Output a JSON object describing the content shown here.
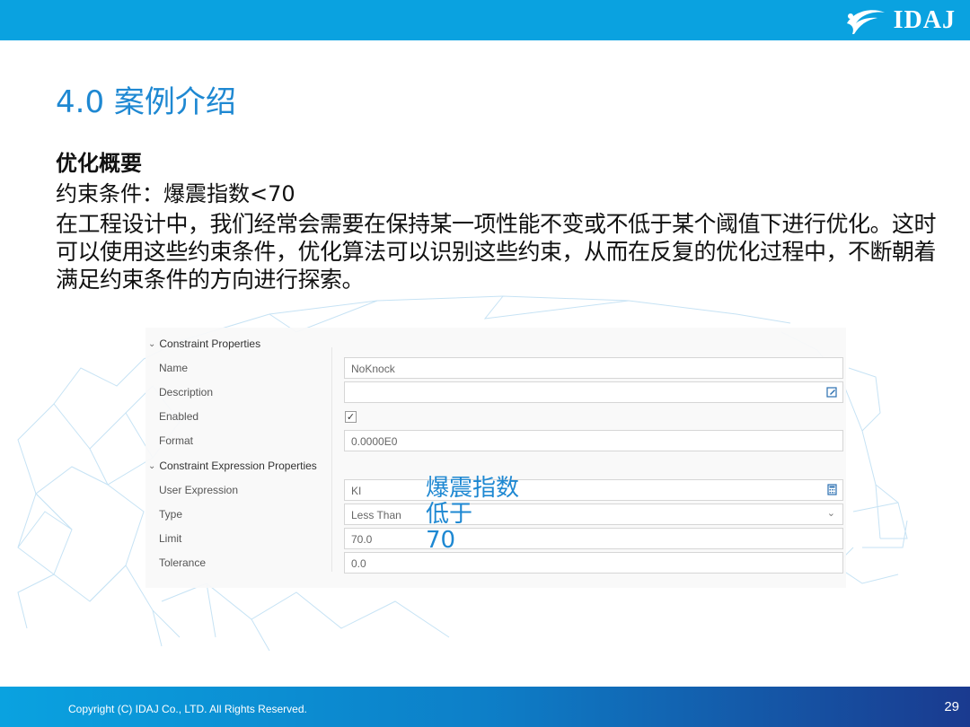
{
  "header": {
    "logo_text": "IDAJ",
    "bar_color": "#0aa2e0"
  },
  "slide": {
    "title": "4.0 案例介绍",
    "subheading": "优化概要",
    "constraint_line": "约束条件：爆震指数<70",
    "paragraph": "在工程设计中，我们经常会需要在保持某一项性能不变或不低于某个阈值下进行优化。这时可以使用这些约束条件，优化算法可以识别这些约束，从而在反复的优化过程中，不断朝着满足约束条件的方向进行探索。"
  },
  "panel": {
    "section1": "Constraint Properties",
    "section2": "Constraint Expression Properties",
    "rows": {
      "name": {
        "label": "Name",
        "value": "NoKnock"
      },
      "description": {
        "label": "Description",
        "value": ""
      },
      "enabled": {
        "label": "Enabled",
        "checked": "✓"
      },
      "format": {
        "label": "Format",
        "value": "0.0000E0"
      },
      "user_expression": {
        "label": "User Expression",
        "value": "KI"
      },
      "type": {
        "label": "Type",
        "value": "Less Than"
      },
      "limit": {
        "label": "Limit",
        "value": "70.0"
      },
      "tolerance": {
        "label": "Tolerance",
        "value": "0.0"
      }
    }
  },
  "annotation": {
    "line1": "爆震指数",
    "line2": "低于",
    "line3": "70",
    "color": "#1e88d2"
  },
  "footer": {
    "copyright": "Copyright (C)  IDAJ Co., LTD. All Rights Reserved.",
    "page_number": "29"
  }
}
